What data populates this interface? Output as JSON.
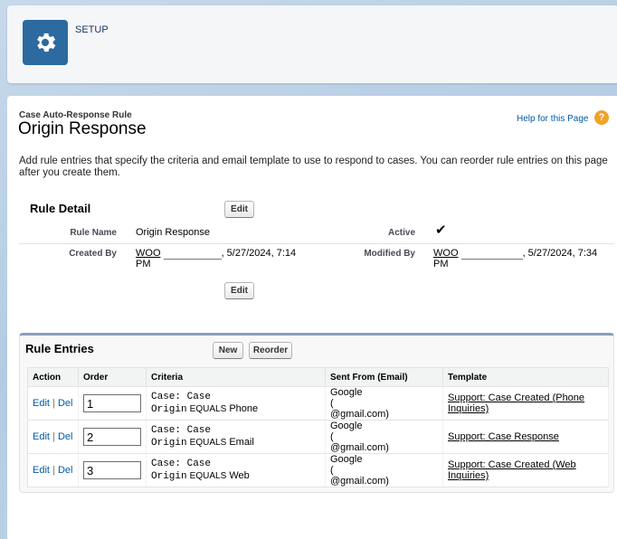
{
  "header": {
    "setup_label": "SETUP"
  },
  "page": {
    "type_label": "Case Auto-Response Rule",
    "title": "Origin Response",
    "help_link": "Help for this Page",
    "description": "Add rule entries that specify the criteria and email template to use to respond to cases. You can reorder rule entries on this page after you create them."
  },
  "rule_detail": {
    "title": "Rule Detail",
    "edit_label": "Edit",
    "rule_name_label": "Rule Name",
    "rule_name_value": "Origin Response",
    "active_label": "Active",
    "active_check": "✔",
    "created_by_label": "Created By",
    "created_by_name": "WOO",
    "created_by_date": ", 5/27/2024, 7:14",
    "created_by_time": "PM",
    "modified_by_label": "Modified By",
    "modified_by_name": "WOO",
    "modified_by_date": ", 5/27/2024, 7:34",
    "modified_by_time": "PM"
  },
  "rule_entries": {
    "title": "Rule Entries",
    "new_label": "New",
    "reorder_label": "Reorder",
    "columns": [
      "Action",
      "Order",
      "Criteria",
      "Sent From (Email)",
      "Template"
    ],
    "edit_link": "Edit",
    "divider": "|",
    "del_link": "Del",
    "rows": [
      {
        "order": "1",
        "criteria_line1": "Case: Case",
        "criteria_field": "Origin",
        "criteria_op": "EQUALS",
        "criteria_value": "Phone",
        "sent_name": "Google",
        "sent_email": "@gmail.com)",
        "template": "Support: Case Created (Phone Inquiries)"
      },
      {
        "order": "2",
        "criteria_line1": "Case: Case",
        "criteria_field": "Origin",
        "criteria_op": "EQUALS",
        "criteria_value": "Email",
        "sent_name": "Google",
        "sent_email": "@gmail.com)",
        "template": "Support: Case Response"
      },
      {
        "order": "3",
        "criteria_line1": "Case: Case",
        "criteria_field": "Origin",
        "criteria_op": "EQUALS",
        "criteria_value": "Web",
        "sent_name": "Google",
        "sent_email": "@gmail.com)",
        "template": "Support: Case Created (Web Inquiries)"
      }
    ]
  },
  "colors": {
    "brand_tile": "#2c6aa0",
    "link": "#015ba7",
    "help_icon": "#f2a22a",
    "section_accent": "#8a9ebe"
  },
  "icons": {
    "setup": "gear-icon",
    "help": "question-circle-icon",
    "active": "checkmark-icon"
  }
}
